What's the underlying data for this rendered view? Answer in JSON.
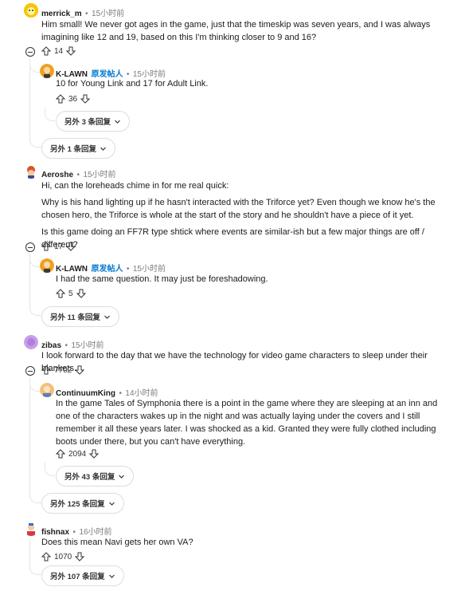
{
  "comments": [
    {
      "id": "merrick",
      "user": "merrick_m",
      "time": "15小时前",
      "text": "Him small! We never got ages in the game, just that the timeskip was seven years, and I was always imagining like 12 and 19, based on this I'm thinking closer to 9 and 16?",
      "votes": "14",
      "reply": {
        "user": "K-LAWN",
        "op_badge": "原发帖人",
        "time": "15小时前",
        "text": "10 for Young Link and 17 for Adult Link.",
        "votes": "36",
        "more_replies": "另外 3 条回复"
      },
      "more_replies": "另外 1 条回复"
    },
    {
      "id": "aeroshe",
      "user": "Aeroshe",
      "time": "15小时前",
      "paragraphs": [
        "Hi, can the loreheads chime in for me real quick:",
        "Why is his hand lighting up if he hasn't interacted with the Triforce yet? Even though we know he's the chosen hero, the Triforce is whole at the start of the story and he shouldn't have a piece of it yet.",
        "Is this game doing an FF7R type shtick where events are similar-ish but a few major things are off / different?"
      ],
      "votes": "17",
      "reply": {
        "user": "K-LAWN",
        "op_badge": "原发帖人",
        "time": "15小时前",
        "text": "I had the same question. It may just be foreshadowing.",
        "votes": "5"
      },
      "more_replies": "另外 11 条回复"
    },
    {
      "id": "zibas",
      "user": "zibas",
      "time": "15小时前",
      "text": "I look forward to the day that we have the technology for video game characters to sleep under their blankets.",
      "votes": "7702",
      "reply": {
        "user": "ContinuumKing",
        "time": "14小时前",
        "text": "In the game Tales of Symphonia there is a point in the game where they are sleeping at an inn and one of the characters wakes up in the night and was actually laying under the covers and I still remember it all these years later. I was shocked as a kid. Granted they were fully clothed including boots under there, but you can't have everything.",
        "votes": "2094",
        "more_replies": "另外 43 条回复"
      },
      "more_replies": "另外 125 条回复"
    },
    {
      "id": "fishnax",
      "user": "fishnax",
      "time": "16小时前",
      "text": "Does this mean Navi gets her own VA?",
      "votes": "1070",
      "more_replies": "另外 107 条回复"
    }
  ],
  "separator": "•",
  "icons": {
    "upvote": "arrow-up-icon",
    "downvote": "arrow-down-icon",
    "collapse": "minus-circle-icon",
    "expand": "chevron-down-icon"
  }
}
